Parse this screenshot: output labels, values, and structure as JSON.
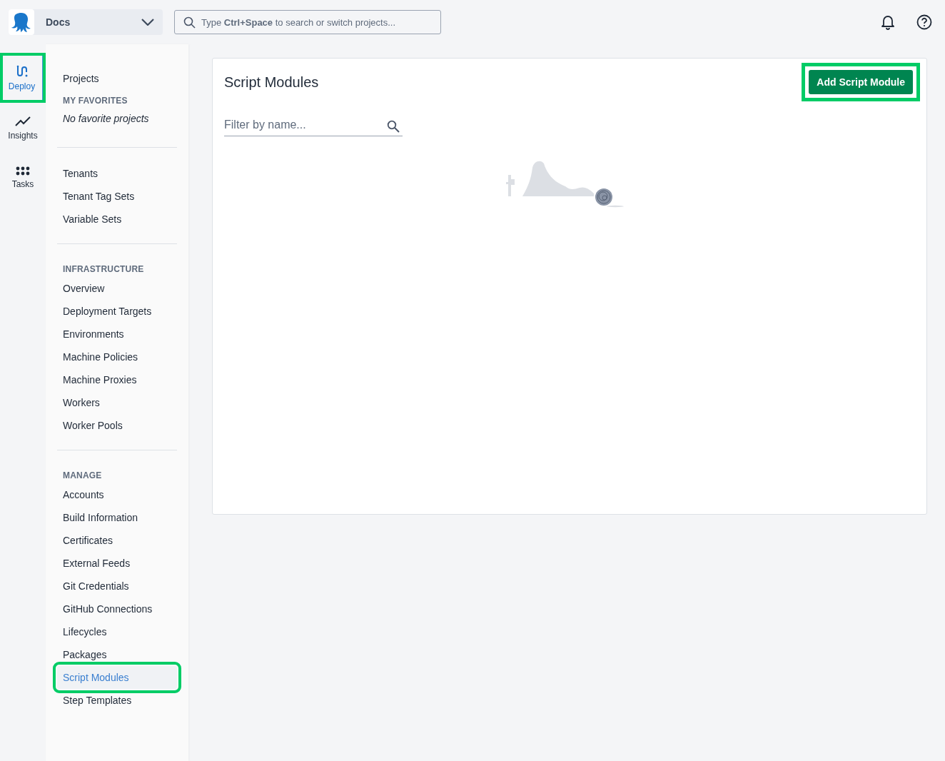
{
  "topbar": {
    "space": "Docs",
    "search_placeholder_parts": [
      "Type ",
      "Ctrl+Space",
      " to search or switch projects..."
    ]
  },
  "rail": [
    {
      "label": "Deploy",
      "selected": true,
      "highlighted": true,
      "kind": "deploy"
    },
    {
      "label": "Insights",
      "selected": false,
      "highlighted": false,
      "kind": "insights"
    },
    {
      "label": "Tasks",
      "selected": false,
      "highlighted": false,
      "kind": "tasks"
    }
  ],
  "sidebar": [
    {
      "items": [
        {
          "label": "Projects",
          "selected": false,
          "highlighted": false
        }
      ],
      "heading": "MY FAVORITES",
      "note": "No favorite projects"
    },
    {
      "items": [
        {
          "label": "Tenants",
          "selected": false,
          "highlighted": false
        },
        {
          "label": "Tenant Tag Sets",
          "selected": false,
          "highlighted": false
        },
        {
          "label": "Variable Sets",
          "selected": false,
          "highlighted": false
        }
      ]
    },
    {
      "heading": "INFRASTRUCTURE",
      "items": [
        {
          "label": "Overview",
          "selected": false,
          "highlighted": false
        },
        {
          "label": "Deployment Targets",
          "selected": false,
          "highlighted": false
        },
        {
          "label": "Environments",
          "selected": false,
          "highlighted": false
        },
        {
          "label": "Machine Policies",
          "selected": false,
          "highlighted": false
        },
        {
          "label": "Machine Proxies",
          "selected": false,
          "highlighted": false
        },
        {
          "label": "Workers",
          "selected": false,
          "highlighted": false
        },
        {
          "label": "Worker Pools",
          "selected": false,
          "highlighted": false
        }
      ]
    },
    {
      "heading": "MANAGE",
      "items": [
        {
          "label": "Accounts",
          "selected": false,
          "highlighted": false
        },
        {
          "label": "Build Information",
          "selected": false,
          "highlighted": false
        },
        {
          "label": "Certificates",
          "selected": false,
          "highlighted": false
        },
        {
          "label": "External Feeds",
          "selected": false,
          "highlighted": false
        },
        {
          "label": "Git Credentials",
          "selected": false,
          "highlighted": false
        },
        {
          "label": "GitHub Connections",
          "selected": false,
          "highlighted": false
        },
        {
          "label": "Lifecycles",
          "selected": false,
          "highlighted": false
        },
        {
          "label": "Packages",
          "selected": false,
          "highlighted": false
        },
        {
          "label": "Script Modules",
          "selected": true,
          "highlighted": true
        },
        {
          "label": "Step Templates",
          "selected": false,
          "highlighted": false
        }
      ]
    }
  ],
  "main": {
    "title": "Script Modules",
    "add_button": {
      "label": "Add Script Module",
      "highlighted": true
    },
    "filter_placeholder": "Filter by name..."
  }
}
